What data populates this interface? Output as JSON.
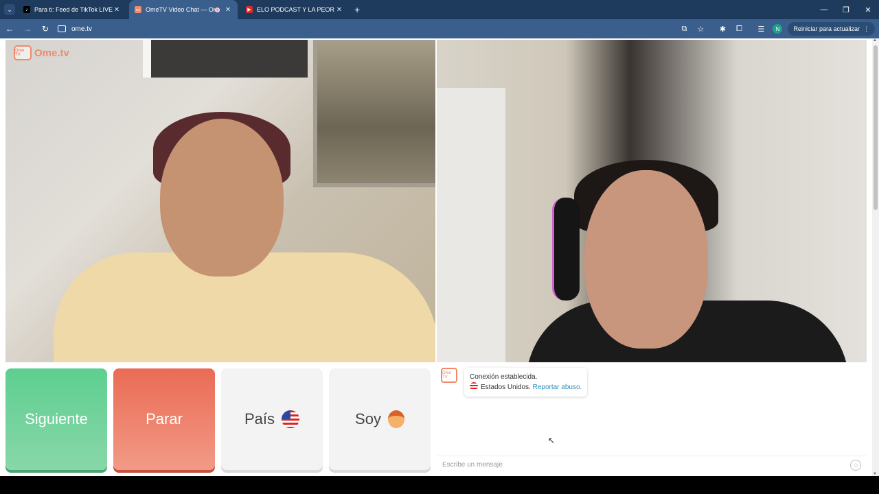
{
  "browser": {
    "tabs": [
      {
        "title": "Para ti: Feed de TikTok LIVE",
        "active": false
      },
      {
        "title": "OmeTV Video Chat — Ome",
        "active": true
      },
      {
        "title": "ELO PODCAST Y LA PEOR ENTR",
        "active": false
      }
    ],
    "new_tab": "+",
    "url": "ome.tv",
    "update_button": "Reiniciar para actualizar",
    "profile_initial": "N"
  },
  "page": {
    "logo_text": "Ome.tv",
    "logo_badge": "Ome TV",
    "buttons": {
      "next": "Siguiente",
      "stop": "Parar",
      "country": "País",
      "gender": "Soy"
    },
    "chat": {
      "avatar_text": "Ome TV",
      "message_line1": "Conexión establecida.",
      "country": "Estados Unidos.",
      "report_link": "Reportar abuso.",
      "input_placeholder": "Escribe un mensaje"
    }
  },
  "colors": {
    "next_button": "#5ecf90",
    "stop_button": "#ea6b55",
    "brand": "#f08a6a",
    "link": "#2b8fb8"
  }
}
